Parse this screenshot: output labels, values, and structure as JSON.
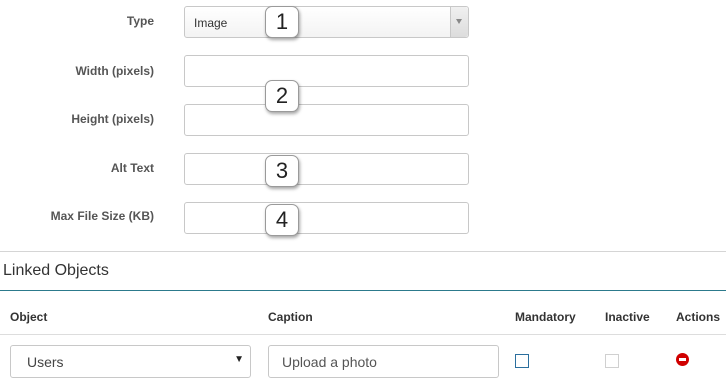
{
  "form": {
    "fields": [
      {
        "label": "Type",
        "value": "Image",
        "badge": "1"
      },
      {
        "label": "Width (pixels)",
        "value": ""
      },
      {
        "label": "Height (pixels)",
        "value": "",
        "badge": "2"
      },
      {
        "label": "Alt Text",
        "value": "",
        "badge": "3"
      },
      {
        "label": "Max File Size (KB)",
        "value": "",
        "badge": "4"
      }
    ]
  },
  "linked_objects": {
    "title": "Linked Objects",
    "columns": [
      "Object",
      "Caption",
      "Mandatory",
      "Inactive",
      "Actions"
    ],
    "rows": [
      {
        "object": "Users",
        "caption": "Upload a photo",
        "mandatory": false,
        "inactive": false
      }
    ]
  },
  "colors": {
    "accent_line": "#2c7a8c",
    "checkbox_border": "#2b6f9e",
    "remove_icon": "#d00000"
  }
}
